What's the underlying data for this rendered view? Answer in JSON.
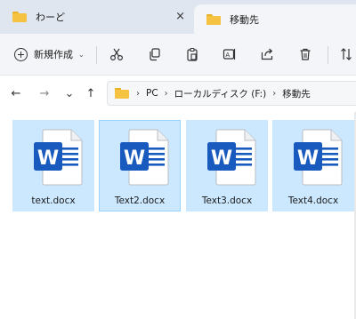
{
  "tabs": [
    {
      "title": "わーど",
      "active": false
    },
    {
      "title": "移動先",
      "active": true
    }
  ],
  "tab_close_glyph": "×",
  "toolbar": {
    "new_label": "新規作成",
    "new_chevron": "⌄",
    "icons": [
      "cut-icon",
      "copy-icon",
      "paste-icon",
      "rename-icon",
      "share-icon",
      "delete-icon",
      "sort-icon"
    ]
  },
  "nav": {
    "back": "←",
    "forward": "→",
    "recent": "⌄",
    "up": "↑"
  },
  "breadcrumb": {
    "items": [
      "PC",
      "ローカルディスク (F:)",
      "移動先"
    ],
    "separator": "›"
  },
  "files": [
    {
      "name": "text.docx",
      "icon": "word-document-icon",
      "letter": "W"
    },
    {
      "name": "Text2.docx",
      "icon": "word-document-icon",
      "letter": "W",
      "focused": true
    },
    {
      "name": "Text3.docx",
      "icon": "word-document-icon",
      "letter": "W"
    },
    {
      "name": "Text4.docx",
      "icon": "word-document-icon",
      "letter": "W"
    }
  ],
  "colors": {
    "selection": "#cce8ff",
    "word_blue": "#185abd",
    "folder_yellow": "#f5c242"
  }
}
